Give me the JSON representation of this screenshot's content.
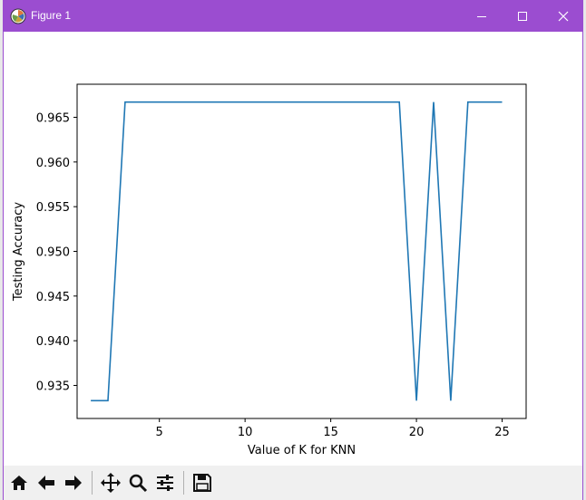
{
  "window": {
    "title": "Figure 1",
    "titlebar_color": "#9b4dd0",
    "controls": {
      "minimize_icon": "minimize-icon",
      "maximize_icon": "maximize-icon",
      "close_icon": "close-icon"
    }
  },
  "toolbar": {
    "tools": [
      {
        "name": "home",
        "icon": "home-icon"
      },
      {
        "name": "back",
        "icon": "arrow-left-icon"
      },
      {
        "name": "forward",
        "icon": "arrow-right-icon"
      },
      {
        "name": "pan",
        "icon": "move-icon"
      },
      {
        "name": "zoom",
        "icon": "magnifier-icon"
      },
      {
        "name": "configure",
        "icon": "sliders-icon"
      },
      {
        "name": "save",
        "icon": "floppy-icon"
      }
    ]
  },
  "chart_data": {
    "type": "line",
    "xlabel": "Value of K for KNN",
    "ylabel": "Testing Accuracy",
    "xlim": [
      0.2,
      26.4
    ],
    "ylim": [
      0.9313,
      0.9687
    ],
    "xticks": [
      5,
      10,
      15,
      20,
      25
    ],
    "xtick_labels": [
      "5",
      "10",
      "15",
      "20",
      "25"
    ],
    "yticks": [
      0.935,
      0.94,
      0.945,
      0.95,
      0.955,
      0.96,
      0.965
    ],
    "ytick_labels": [
      "0.935",
      "0.940",
      "0.945",
      "0.950",
      "0.955",
      "0.960",
      "0.965"
    ],
    "grid": false,
    "line_color": "#1f77b4",
    "series": [
      {
        "x": [
          1,
          2,
          3,
          4,
          5,
          6,
          7,
          8,
          9,
          10,
          11,
          12,
          13,
          14,
          15,
          16,
          17,
          18,
          19,
          20,
          21,
          22,
          23,
          24,
          25
        ],
        "values": [
          0.9333,
          0.9333,
          0.9667,
          0.9667,
          0.9667,
          0.9667,
          0.9667,
          0.9667,
          0.9667,
          0.9667,
          0.9667,
          0.9667,
          0.9667,
          0.9667,
          0.9667,
          0.9667,
          0.9667,
          0.9667,
          0.9667,
          0.9333,
          0.9667,
          0.9333,
          0.9667,
          0.9667,
          0.9667
        ]
      }
    ]
  }
}
